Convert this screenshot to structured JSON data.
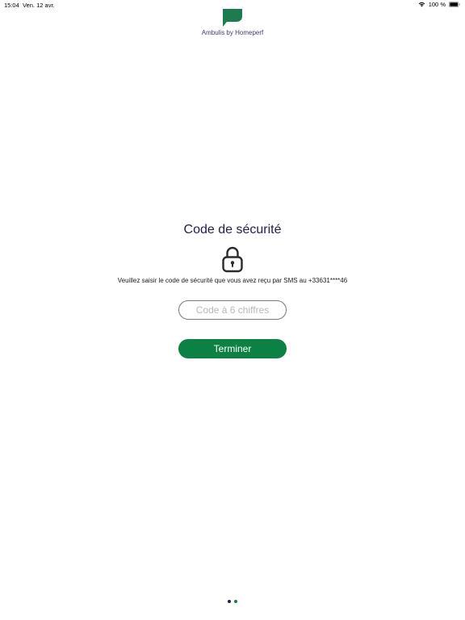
{
  "status_bar": {
    "time": "15:04",
    "date": "Ven. 12 avr.",
    "battery": "100 %",
    "wifi_icon": "wifi-icon",
    "battery_icon": "battery-full-icon"
  },
  "header": {
    "logo_icon": "flag-logo-icon",
    "app_name": "Ambulis by Homeperf"
  },
  "main": {
    "title": "Code de sécurité",
    "lock_icon": "padlock-icon",
    "instructions": "Veuillez saisir le code de sécurité que vous avez reçu par SMS au +33631****46",
    "code_input": {
      "value": "",
      "placeholder": "Code à 6 chiffres"
    },
    "submit_label": "Terminer"
  },
  "pagination": {
    "count": 2,
    "colors": [
      "#23204d",
      "#0c8143"
    ]
  },
  "colors": {
    "brand_green": "#0c8143",
    "brand_navy": "#23204d",
    "logo_text": "#3f3a72"
  }
}
